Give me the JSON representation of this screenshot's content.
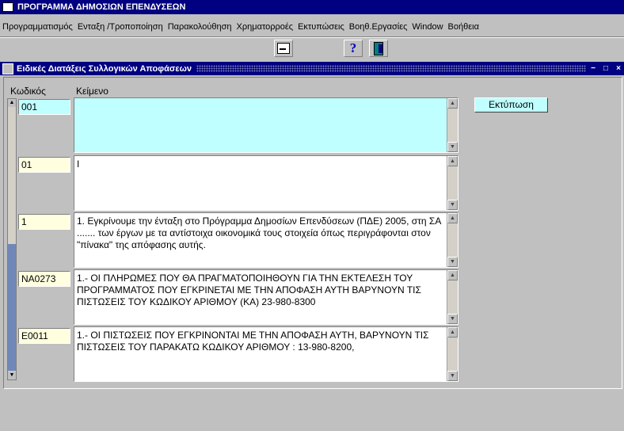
{
  "window": {
    "title": "ΠΡΟΓΡΑΜΜΑ ΔΗΜΟΣΙΩΝ ΕΠΕΝΔΥΣΕΩΝ"
  },
  "menu": [
    "Προγραμματισμός",
    "Ενταξη /Τροποποίηση",
    "Παρακολούθηση",
    "Χρηματορροές",
    "Εκτυπώσεις",
    "Βοηθ.Εργασίες",
    "Window",
    "Βοήθεια"
  ],
  "toolbar": {
    "icons": [
      "printer-icon",
      "help-icon",
      "exit-door-icon"
    ],
    "help_glyph": "?"
  },
  "form": {
    "title": "Ειδικές Διατάξεις Συλλογικών Αποφάσεων",
    "col_code": "Κωδικός",
    "col_text": "Κείμενο",
    "print_button": "Εκτύπωση"
  },
  "records": [
    {
      "code": "001",
      "text": "",
      "selected": true
    },
    {
      "code": "01",
      "text": "I",
      "selected": false
    },
    {
      "code": "1",
      "text": "1. Εγκρίνουμε την ένταξη στο Πρόγραμμα Δημοσίων Επενδύσεων (ΠΔΕ) 2005, στη ΣΑ ....... των έργων  με τα αντίστοιχα οικονομικά τους στοιχεία όπως περιγράφονται στον \"πίνακα\" της απόφασης αυτής.",
      "selected": false
    },
    {
      "code": "NA0273",
      "text": "1.- ΟΙ ΠΛΗΡΩΜΕΣ ΠΟΥ ΘΑ ΠΡΑΓΜΑΤΟΠΟΙΗΘΟΥΝ ΓΙΑ ΤΗΝ ΕΚΤΕΛΕΣΗ ΤΟΥ ΠΡΟΓΡΑΜΜΑΤΟΣ ΠΟΥ ΕΓΚΡΙΝΕΤΑΙ ΜΕ ΤΗΝ ΑΠΟΦΑΣΗ ΑΥΤΗ ΒΑΡΥΝΟΥΝ ΤΙΣ ΠΙΣΤΩΣΕΙΣ ΤΟΥ ΚΩΔΙΚΟΥ ΑΡΙΘΜΟΥ (ΚΑ) 23-980-8300",
      "selected": false
    },
    {
      "code": "E0011",
      "text": "1.- ΟΙ ΠΙΣΤΩΣΕΙΣ ΠΟΥ ΕΓΚΡΙΝΟΝΤΑΙ  ΜΕ ΤΗΝ ΑΠΟΦΑΣΗ ΑΥΤΗ, ΒΑΡΥΝΟΥΝ ΤΙΣ ΠΙΣΤΩΣΕΙΣ ΤΟΥ ΠΑΡΑΚΑΤΩ  ΚΩΔΙΚΟΥ  ΑΡΙΘΜΟΥ : 13-980-8200,",
      "selected": false
    }
  ],
  "colors": {
    "title_bar": "#000080",
    "selected_field": "#bfffff",
    "field": "#ffffe0",
    "text_field": "#ffffff",
    "button": "#bfffff"
  }
}
